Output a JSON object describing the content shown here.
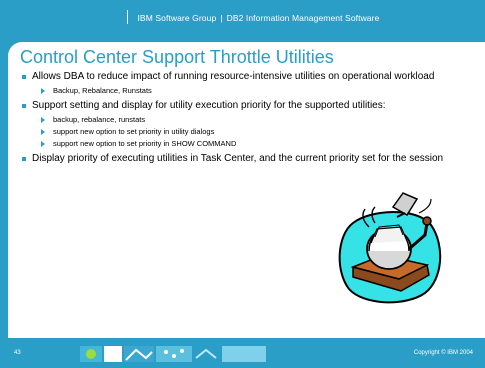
{
  "header": {
    "left_text": "IBM Software Group",
    "right_text": "DB2 Information Management Software"
  },
  "slide": {
    "title": "Control Center Support Throttle Utilities",
    "bullets": [
      {
        "text": "Allows DBA to reduce impact of running resource-intensive utilities on operational workload",
        "sub": [
          "Backup, Rebalance, Runstats"
        ]
      },
      {
        "text": "Support setting and display for utility execution priority for the supported utilities:",
        "sub": [
          "backup, rebalance, runstats",
          "support new option to set priority in utility dialogs",
          "support new option to set priority in SHOW COMMAND"
        ]
      },
      {
        "text": "Display priority of executing utilities in Task Center, and the current priority set for the session",
        "sub": []
      }
    ]
  },
  "footer": {
    "page_number": "43",
    "copyright": "Copyright © IBM 2004"
  },
  "colors": {
    "brand_teal": "#2a9ec6",
    "text": "#000000"
  },
  "clipart_icon": "rolodex-card-file-icon"
}
